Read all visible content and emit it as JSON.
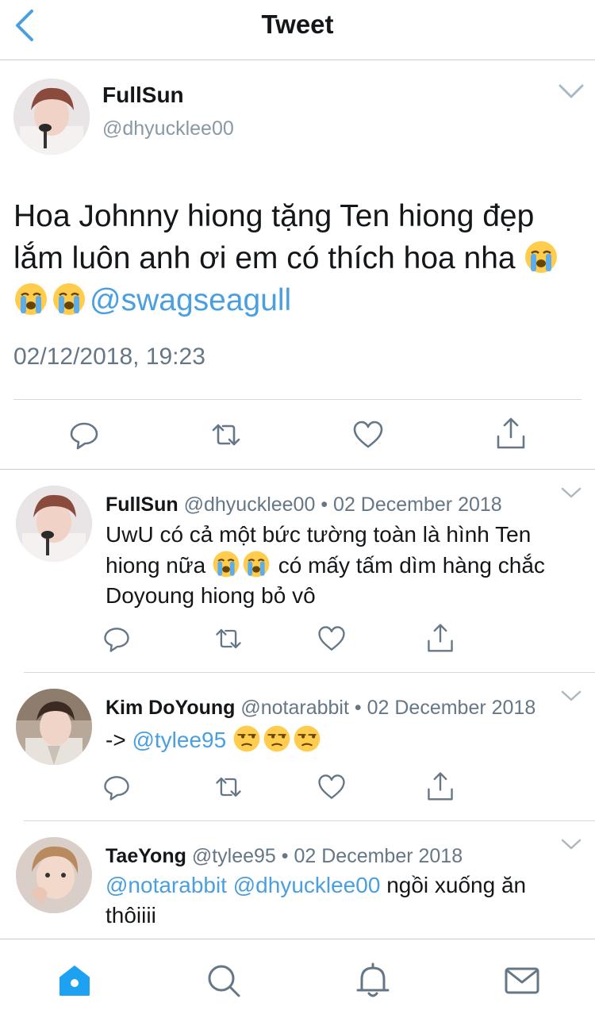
{
  "header": {
    "title": "Tweet",
    "back_icon": "chevron-left-icon"
  },
  "main_tweet": {
    "name": "FullSun",
    "handle": "@dhyucklee00",
    "text_part1": "Hoa Johnny hiong tặng Ten hiong đẹp lắm luôn anh ơi em có thích hoa nha",
    "emojis": [
      "loudly-crying-face",
      "loudly-crying-face",
      "loudly-crying-face"
    ],
    "mention": "@swagseagull",
    "timestamp": "02/12/2018, 19:23",
    "actions": [
      "reply-icon",
      "retweet-icon",
      "like-icon",
      "share-icon"
    ]
  },
  "replies": [
    {
      "name": "FullSun",
      "handle": "@dhyucklee00",
      "dot": "•",
      "date": "02 December 2018",
      "text_a": "UwU có cả một bức tường toàn là hình Ten hiong nữa",
      "emojis": [
        "loudly-crying-face",
        "loudly-crying-face"
      ],
      "text_b": "có mấy tấm dìm hàng chắc Doyoung hiong bỏ vô"
    },
    {
      "name": "Kim DoYoung",
      "handle": "@notarabbit",
      "dot": "•",
      "date": "02 December 2018",
      "prefix": "->",
      "mention": "@tylee95",
      "emojis": [
        "unamused-face",
        "unamused-face",
        "unamused-face"
      ]
    },
    {
      "name": "TaeYong",
      "handle": "@tylee95",
      "dot": "•",
      "date": "02 December 2018",
      "mention1": "@notarabbit",
      "mention2": "@dhyucklee00",
      "text": "ngồi xuống ăn thôiiii"
    }
  ],
  "tabbar": {
    "items": [
      "home-icon",
      "search-icon",
      "notifications-icon",
      "messages-icon"
    ],
    "active": "home-icon",
    "accent": "#1da1f2"
  }
}
